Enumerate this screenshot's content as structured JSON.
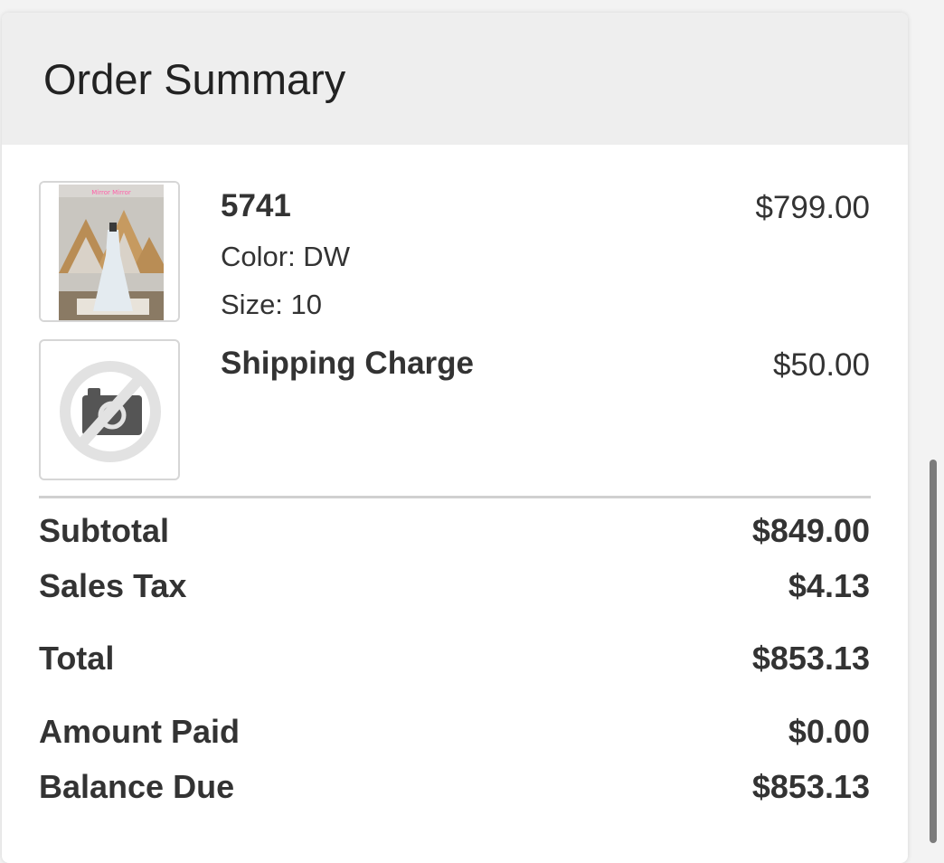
{
  "header": {
    "title": "Order Summary"
  },
  "items": [
    {
      "name": "5741",
      "color": "Color: DW",
      "size": "Size: 10",
      "price": "$799.00",
      "thumbnail": "dress-photo"
    },
    {
      "name": "Shipping Charge",
      "price": "$50.00",
      "thumbnail": "no-image-icon"
    }
  ],
  "totals": {
    "subtotal_label": "Subtotal",
    "subtotal_value": "$849.00",
    "tax_label": "Sales Tax",
    "tax_value": "$4.13",
    "total_label": "Total",
    "total_value": "$853.13",
    "paid_label": "Amount Paid",
    "paid_value": "$0.00",
    "balance_label": "Balance Due",
    "balance_value": "$853.13"
  },
  "colors": {
    "header_bg": "#eeeeee",
    "text": "#333333",
    "scrollbar": "#7c7c7c"
  }
}
